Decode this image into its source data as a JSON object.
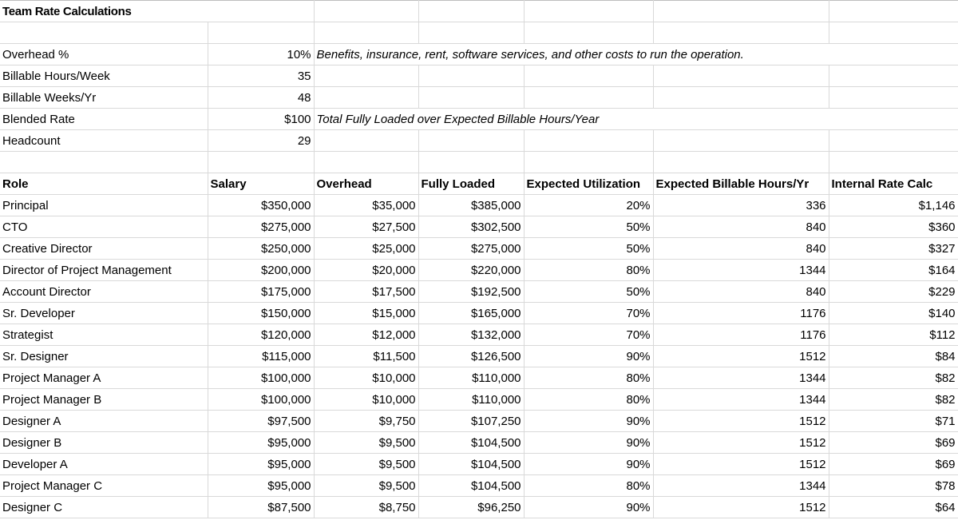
{
  "sheet": {
    "title": "Team Rate Calculations",
    "accent_blue": "#0000FF",
    "gridline": "#D9D9D9"
  },
  "assumptions": {
    "rows": [
      {
        "label": "Overhead %",
        "value": "10%",
        "value_blue": true,
        "note": "Benefits, insurance, rent, software services, and other costs to run the operation."
      },
      {
        "label": "Billable Hours/Week",
        "value": "35",
        "value_blue": true,
        "note": ""
      },
      {
        "label": "Billable Weeks/Yr",
        "value": "48",
        "value_blue": true,
        "note": ""
      },
      {
        "label": "Blended Rate",
        "value": "$100",
        "value_blue": false,
        "note": "Total Fully Loaded over Expected Billable Hours/Year"
      },
      {
        "label": "Headcount",
        "value": "29",
        "value_blue": false,
        "note": ""
      }
    ]
  },
  "table": {
    "headers": [
      "Role",
      "Salary",
      "Overhead",
      "Fully Loaded",
      "Expected Utilization",
      "Expected Billable Hours/Yr",
      "Internal Rate Calc"
    ],
    "rows": [
      {
        "role": "Principal",
        "salary": "$350,000",
        "overhead": "$35,000",
        "fully_loaded": "$385,000",
        "utilization": "20%",
        "billable_hours": "336",
        "internal_rate": "$1,146"
      },
      {
        "role": "CTO",
        "salary": "$275,000",
        "overhead": "$27,500",
        "fully_loaded": "$302,500",
        "utilization": "50%",
        "billable_hours": "840",
        "internal_rate": "$360"
      },
      {
        "role": "Creative Director",
        "salary": "$250,000",
        "overhead": "$25,000",
        "fully_loaded": "$275,000",
        "utilization": "50%",
        "billable_hours": "840",
        "internal_rate": "$327"
      },
      {
        "role": "Director of Project Management",
        "salary": "$200,000",
        "overhead": "$20,000",
        "fully_loaded": "$220,000",
        "utilization": "80%",
        "billable_hours": "1344",
        "internal_rate": "$164"
      },
      {
        "role": "Account Director",
        "salary": "$175,000",
        "overhead": "$17,500",
        "fully_loaded": "$192,500",
        "utilization": "50%",
        "billable_hours": "840",
        "internal_rate": "$229"
      },
      {
        "role": "Sr. Developer",
        "salary": "$150,000",
        "overhead": "$15,000",
        "fully_loaded": "$165,000",
        "utilization": "70%",
        "billable_hours": "1176",
        "internal_rate": "$140"
      },
      {
        "role": "Strategist",
        "salary": "$120,000",
        "overhead": "$12,000",
        "fully_loaded": "$132,000",
        "utilization": "70%",
        "billable_hours": "1176",
        "internal_rate": "$112"
      },
      {
        "role": "Sr. Designer",
        "salary": "$115,000",
        "overhead": "$11,500",
        "fully_loaded": "$126,500",
        "utilization": "90%",
        "billable_hours": "1512",
        "internal_rate": "$84"
      },
      {
        "role": "Project Manager A",
        "salary": "$100,000",
        "overhead": "$10,000",
        "fully_loaded": "$110,000",
        "utilization": "80%",
        "billable_hours": "1344",
        "internal_rate": "$82"
      },
      {
        "role": "Project Manager B",
        "salary": "$100,000",
        "overhead": "$10,000",
        "fully_loaded": "$110,000",
        "utilization": "80%",
        "billable_hours": "1344",
        "internal_rate": "$82"
      },
      {
        "role": "Designer A",
        "salary": "$97,500",
        "overhead": "$9,750",
        "fully_loaded": "$107,250",
        "utilization": "90%",
        "billable_hours": "1512",
        "internal_rate": "$71"
      },
      {
        "role": "Designer B",
        "salary": "$95,000",
        "overhead": "$9,500",
        "fully_loaded": "$104,500",
        "utilization": "90%",
        "billable_hours": "1512",
        "internal_rate": "$69"
      },
      {
        "role": "Developer A",
        "salary": "$95,000",
        "overhead": "$9,500",
        "fully_loaded": "$104,500",
        "utilization": "90%",
        "billable_hours": "1512",
        "internal_rate": "$69"
      },
      {
        "role": "Project Manager C",
        "salary": "$95,000",
        "overhead": "$9,500",
        "fully_loaded": "$104,500",
        "utilization": "80%",
        "billable_hours": "1344",
        "internal_rate": "$78"
      },
      {
        "role": "Designer C",
        "salary": "$87,500",
        "overhead": "$8,750",
        "fully_loaded": "$96,250",
        "utilization": "90%",
        "billable_hours": "1512",
        "internal_rate": "$64"
      }
    ]
  }
}
